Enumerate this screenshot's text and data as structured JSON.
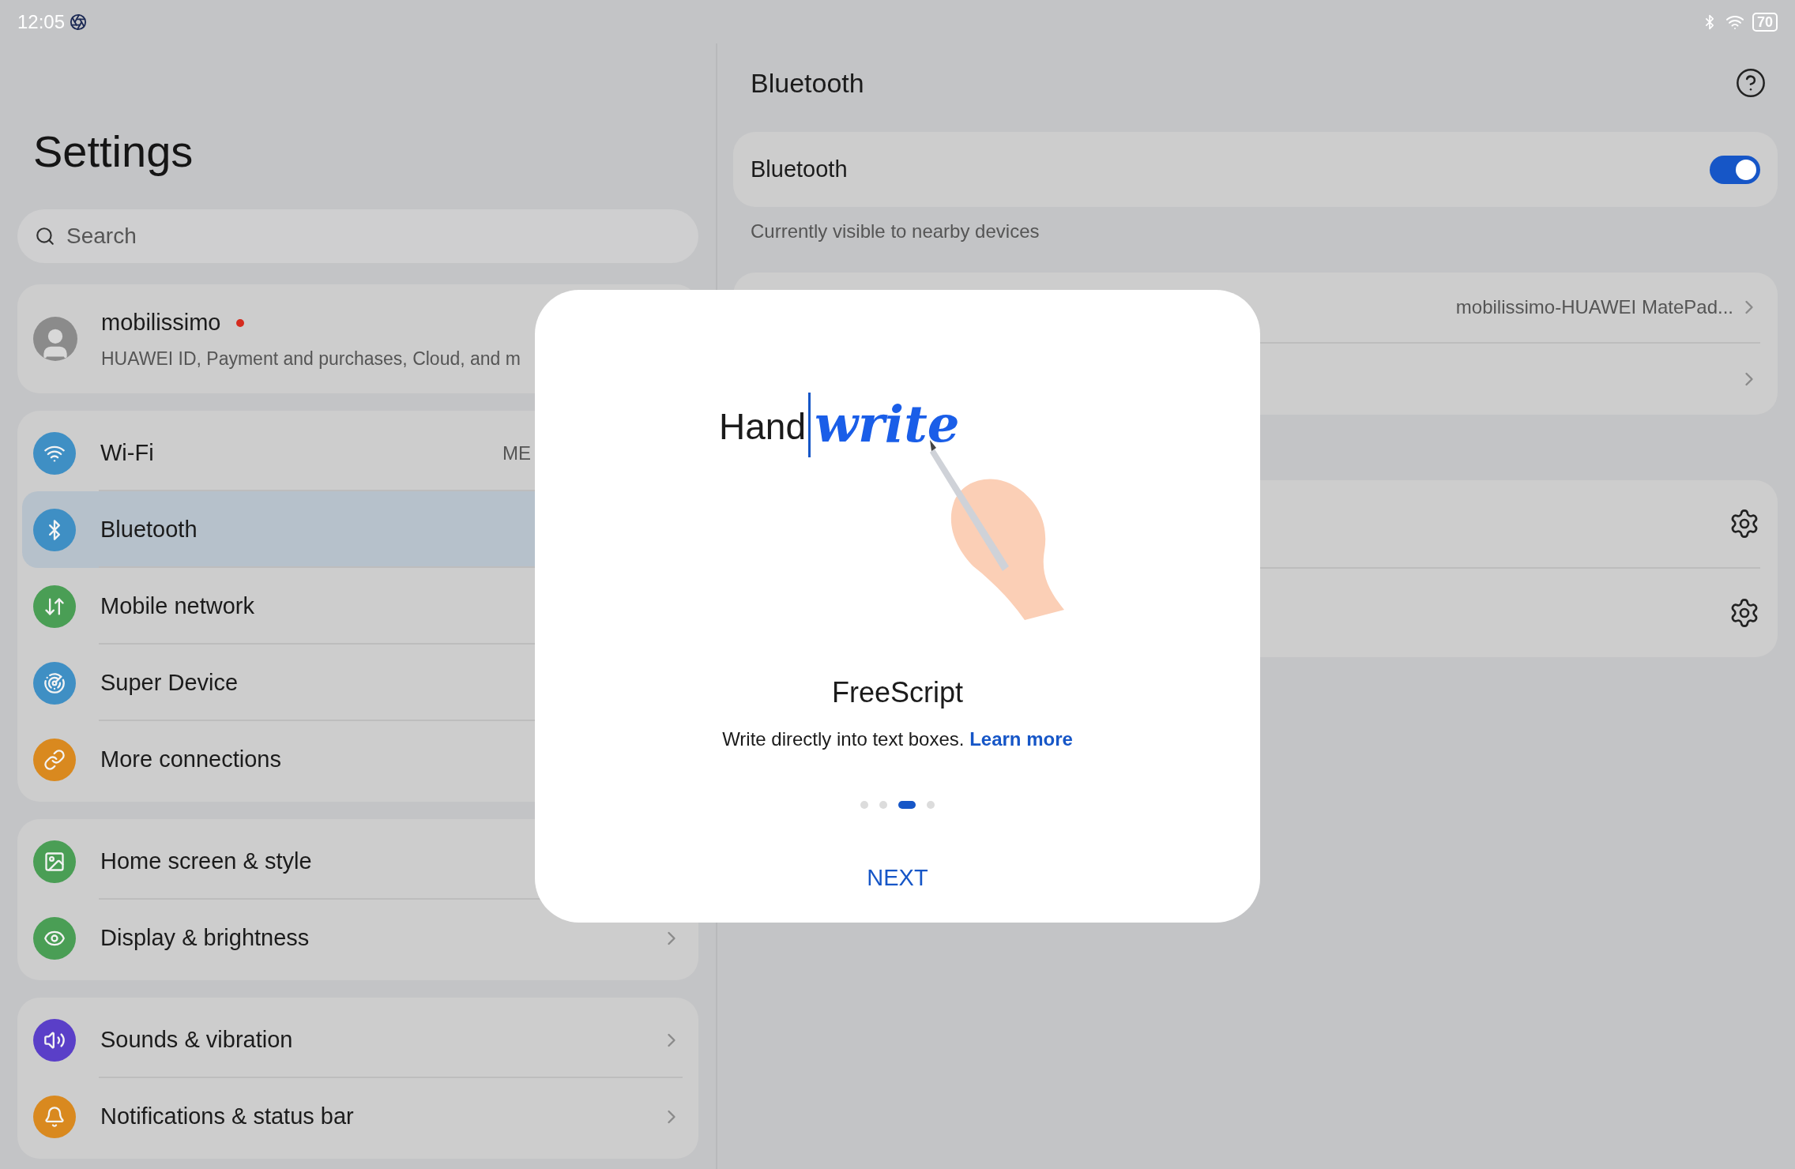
{
  "status_bar": {
    "time": "12:05",
    "battery": "70"
  },
  "settings": {
    "title": "Settings",
    "search": {
      "placeholder": "Search"
    },
    "profile": {
      "name": "mobilissimo",
      "notification_dot": true,
      "subtitle": "HUAWEI ID, Payment and purchases, Cloud, and m"
    },
    "groups": [
      {
        "items": [
          {
            "label": "Wi-Fi",
            "value": "ME",
            "color": "#3f8fc4",
            "selected": false,
            "chevron": false
          },
          {
            "label": "Bluetooth",
            "color": "#3f8fc4",
            "selected": true,
            "chevron": false
          },
          {
            "label": "Mobile network",
            "color": "#4a9e55",
            "selected": false,
            "chevron": false
          },
          {
            "label": "Super Device",
            "color": "#3f8fc4",
            "selected": false,
            "chevron": false
          },
          {
            "label": "More connections",
            "color": "#d9891f",
            "selected": false,
            "chevron": false
          }
        ]
      },
      {
        "items": [
          {
            "label": "Home screen & style",
            "color": "#4a9e55",
            "selected": false,
            "chevron": false
          },
          {
            "label": "Display & brightness",
            "color": "#4a9e55",
            "selected": false,
            "chevron": true
          }
        ]
      },
      {
        "items": [
          {
            "label": "Sounds & vibration",
            "color": "#5a3fc8",
            "selected": false,
            "chevron": true
          },
          {
            "label": "Notifications & status bar",
            "color": "#d9891f",
            "selected": false,
            "chevron": true
          }
        ]
      }
    ]
  },
  "bluetooth": {
    "title": "Bluetooth",
    "toggle": {
      "label": "Bluetooth",
      "on": true
    },
    "caption": "Currently visible to nearby devices",
    "info_rows": [
      {
        "value": "mobilissimo-HUAWEI MatePad...",
        "chevron": true
      },
      {
        "chevron": true
      }
    ],
    "gear_rows": [
      {
        "gear": true
      },
      {
        "gear": true
      }
    ]
  },
  "dialog": {
    "illustration": {
      "typed": "Hand",
      "handwritten": "write"
    },
    "title": "FreeScript",
    "description": "Write directly into text boxes.",
    "link": "Learn more",
    "pages": [
      {
        "selected": false
      },
      {
        "selected": false
      },
      {
        "selected": true
      },
      {
        "selected": false
      }
    ],
    "button": "NEXT"
  }
}
